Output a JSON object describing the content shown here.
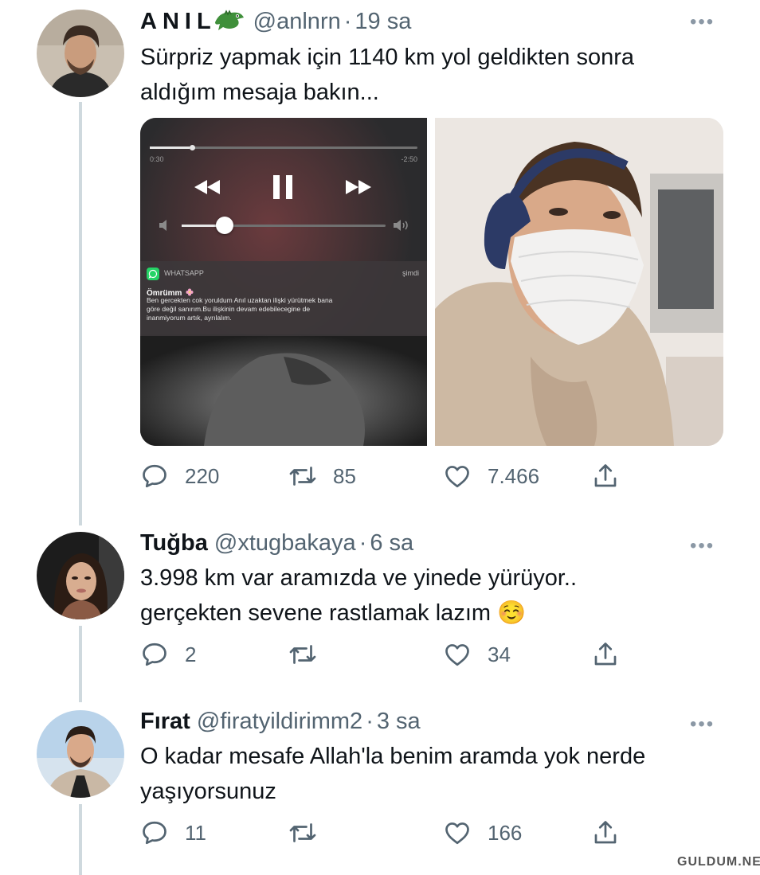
{
  "tweets": [
    {
      "name": "ANIL",
      "handle": "@anlnrn",
      "time": "19 sa",
      "text_lines": [
        "Sürpriz yapmak için 1140 km yol geldikten sonra",
        "aldığım mesaja bakın..."
      ],
      "replies": "220",
      "retweets": "85",
      "likes": "7.466",
      "media": {
        "player": {
          "elapsed": "0:30",
          "remaining": "-2:50"
        },
        "notification": {
          "app": "WHATSAPP",
          "time": "şimdi",
          "sender": "Ömrümm",
          "message_lines": [
            "Ben gercekten cok yoruldum Anıl uzaktan ilişki yürütmek bana",
            "göre değil sanırım.Bu ilişkinin devam edebilecegine de",
            "inanmiyorum artık, ayrılalım."
          ]
        }
      }
    },
    {
      "name": "Tuğba",
      "handle": "@xtugbakaya",
      "time": "6 sa",
      "text_lines": [
        "3.998 km var aramızda ve yinede yürüyor..",
        "gerçekten sevene rastlamak lazım ☺️"
      ],
      "replies": "2",
      "retweets": "",
      "likes": "34"
    },
    {
      "name": "Fırat",
      "handle": "@firatyildirimm2",
      "time": "3 sa",
      "text_lines": [
        "O kadar mesafe Allah'la benim aramda yok nerde",
        "yaşıyorsunuz"
      ],
      "replies": "11",
      "retweets": "",
      "likes": "166"
    }
  ],
  "watermark": "GULDUM.NET",
  "icons": [
    "crocodile-emoji-icon",
    "more-icon",
    "reply-icon",
    "retweet-icon",
    "like-icon",
    "share-icon",
    "rewind-icon",
    "pause-icon",
    "fast-forward-icon",
    "volume-low-icon",
    "volume-high-icon",
    "whatsapp-icon",
    "flower-emoji-icon"
  ],
  "colors": {
    "text": "#0f1419",
    "secondary": "#536471",
    "thread_line": "#cfd9de",
    "whatsapp_green": "#25d366"
  }
}
